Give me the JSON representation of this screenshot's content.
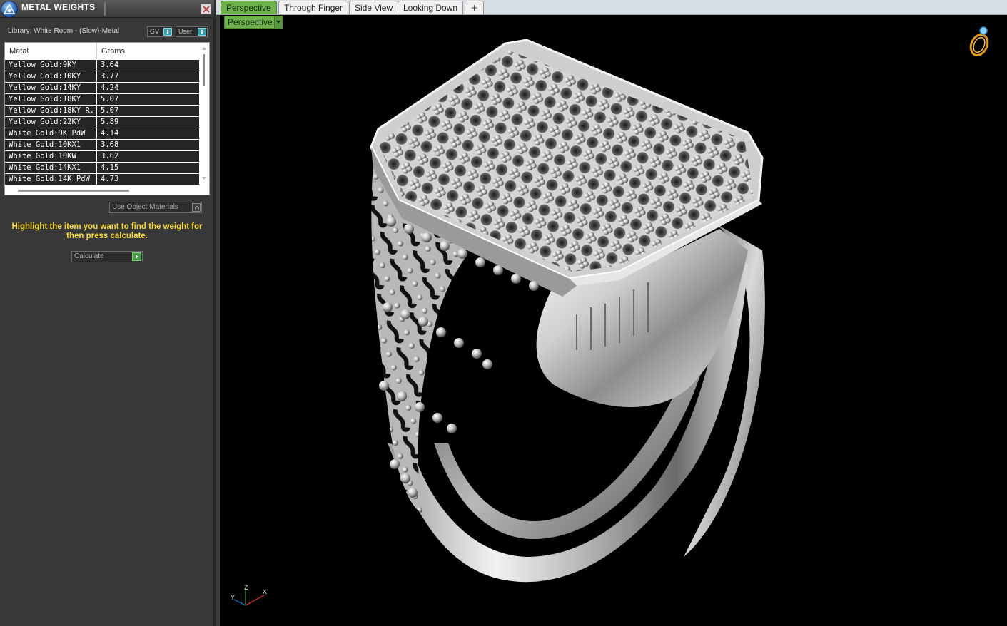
{
  "panel": {
    "title": "METAL WEIGHTS",
    "library_label": "Library: White Room - (Slow)-Metal",
    "toggle_gv": "GV",
    "toggle_user": "User",
    "table": {
      "headers": [
        "Metal",
        "Grams"
      ],
      "rows": [
        {
          "metal": "Yellow Gold:9KY",
          "grams": "3.64"
        },
        {
          "metal": "Yellow Gold:10KY",
          "grams": "3.77"
        },
        {
          "metal": "Yellow Gold:14KY",
          "grams": "4.24"
        },
        {
          "metal": "Yellow Gold:18KY",
          "grams": "5.07"
        },
        {
          "metal": "Yellow Gold:18KY R...",
          "grams": "5.07"
        },
        {
          "metal": "Yellow Gold:22KY",
          "grams": "5.89"
        },
        {
          "metal": "White Gold:9K PdW",
          "grams": "4.14"
        },
        {
          "metal": "White Gold:10KX1",
          "grams": "3.68"
        },
        {
          "metal": "White Gold:10KW",
          "grams": "3.62"
        },
        {
          "metal": "White Gold:14KX1",
          "grams": "4.15"
        },
        {
          "metal": "White Gold:14K PdW",
          "grams": "4.73"
        }
      ]
    },
    "use_object_materials": "Use Object Materials",
    "hint": "Highlight the item you want to find the weight for then press calculate.",
    "calculate": "Calculate",
    "colors": {
      "hint": "#f5d63a",
      "panel_bg": "#383838",
      "active_tab": "#6fb04f"
    }
  },
  "tabs": [
    "Perspective",
    "Through Finger",
    "Side View",
    "Looking Down"
  ],
  "active_tab": "Perspective",
  "viewport": {
    "view_select": "Perspective",
    "axis": {
      "x": "X",
      "y": "Y",
      "z": "Z"
    },
    "model": "silver signet ring with pavé dome pattern"
  }
}
